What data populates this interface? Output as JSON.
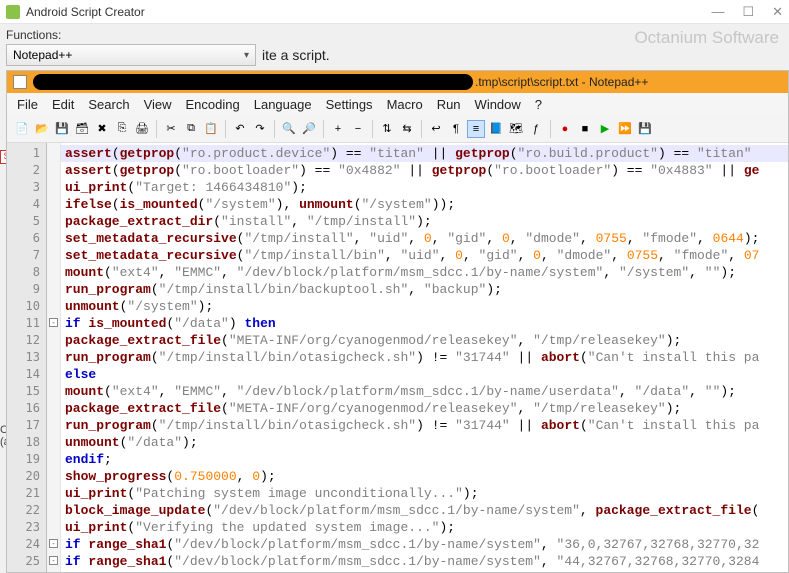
{
  "outer": {
    "title": "Android Script Creator",
    "win_min": "—",
    "win_max": "☐",
    "win_close": "✕",
    "functions_label": "Functions:",
    "selected_function": "Notepad++",
    "hint": "ite a script.",
    "brand": "Octanium Software"
  },
  "npp": {
    "title_path": ".tmp\\script\\script.txt - Notepad++",
    "menu": [
      "File",
      "Edit",
      "Search",
      "View",
      "Encoding",
      "Language",
      "Settings",
      "Macro",
      "Run",
      "Window",
      "?"
    ]
  },
  "code": {
    "lines": [
      {
        "n": 1,
        "hl": true,
        "tokens": [
          [
            "fn",
            "assert"
          ],
          [
            "op",
            "("
          ],
          [
            "fn",
            "getprop"
          ],
          [
            "op",
            "("
          ],
          [
            "str",
            "\"ro.product.device\""
          ],
          [
            "op",
            ") == "
          ],
          [
            "str",
            "\"titan\""
          ],
          [
            "op",
            " || "
          ],
          [
            "fn",
            "getprop"
          ],
          [
            "op",
            "("
          ],
          [
            "str",
            "\"ro.build.product\""
          ],
          [
            "op",
            ") == "
          ],
          [
            "str",
            "\"titan\""
          ]
        ]
      },
      {
        "n": 2,
        "tokens": [
          [
            "fn",
            "assert"
          ],
          [
            "op",
            "("
          ],
          [
            "fn",
            "getprop"
          ],
          [
            "op",
            "("
          ],
          [
            "str",
            "\"ro.bootloader\""
          ],
          [
            "op",
            ") == "
          ],
          [
            "str",
            "\"0x4882\""
          ],
          [
            "op",
            " || "
          ],
          [
            "fn",
            "getprop"
          ],
          [
            "op",
            "("
          ],
          [
            "str",
            "\"ro.bootloader\""
          ],
          [
            "op",
            ") == "
          ],
          [
            "str",
            "\"0x4883\""
          ],
          [
            "op",
            " || "
          ],
          [
            "fn",
            "ge"
          ]
        ]
      },
      {
        "n": 3,
        "tokens": [
          [
            "fn",
            "ui_print"
          ],
          [
            "op",
            "("
          ],
          [
            "str",
            "\"Target: 1466434810\""
          ],
          [
            "op",
            ");"
          ]
        ]
      },
      {
        "n": 4,
        "tokens": [
          [
            "fn",
            "ifelse"
          ],
          [
            "op",
            "("
          ],
          [
            "fn",
            "is_mounted"
          ],
          [
            "op",
            "("
          ],
          [
            "str",
            "\"/system\""
          ],
          [
            "op",
            "), "
          ],
          [
            "fn",
            "unmount"
          ],
          [
            "op",
            "("
          ],
          [
            "str",
            "\"/system\""
          ],
          [
            "op",
            "));"
          ]
        ]
      },
      {
        "n": 5,
        "tokens": [
          [
            "fn",
            "package_extract_dir"
          ],
          [
            "op",
            "("
          ],
          [
            "str",
            "\"install\""
          ],
          [
            "op",
            ", "
          ],
          [
            "str",
            "\"/tmp/install\""
          ],
          [
            "op",
            ");"
          ]
        ]
      },
      {
        "n": 6,
        "tokens": [
          [
            "fn",
            "set_metadata_recursive"
          ],
          [
            "op",
            "("
          ],
          [
            "str",
            "\"/tmp/install\""
          ],
          [
            "op",
            ", "
          ],
          [
            "str",
            "\"uid\""
          ],
          [
            "op",
            ", "
          ],
          [
            "num",
            "0"
          ],
          [
            "op",
            ", "
          ],
          [
            "str",
            "\"gid\""
          ],
          [
            "op",
            ", "
          ],
          [
            "num",
            "0"
          ],
          [
            "op",
            ", "
          ],
          [
            "str",
            "\"dmode\""
          ],
          [
            "op",
            ", "
          ],
          [
            "num",
            "0755"
          ],
          [
            "op",
            ", "
          ],
          [
            "str",
            "\"fmode\""
          ],
          [
            "op",
            ", "
          ],
          [
            "num",
            "0644"
          ],
          [
            "op",
            ");"
          ]
        ]
      },
      {
        "n": 7,
        "tokens": [
          [
            "fn",
            "set_metadata_recursive"
          ],
          [
            "op",
            "("
          ],
          [
            "str",
            "\"/tmp/install/bin\""
          ],
          [
            "op",
            ", "
          ],
          [
            "str",
            "\"uid\""
          ],
          [
            "op",
            ", "
          ],
          [
            "num",
            "0"
          ],
          [
            "op",
            ", "
          ],
          [
            "str",
            "\"gid\""
          ],
          [
            "op",
            ", "
          ],
          [
            "num",
            "0"
          ],
          [
            "op",
            ", "
          ],
          [
            "str",
            "\"dmode\""
          ],
          [
            "op",
            ", "
          ],
          [
            "num",
            "0755"
          ],
          [
            "op",
            ", "
          ],
          [
            "str",
            "\"fmode\""
          ],
          [
            "op",
            ", "
          ],
          [
            "num",
            "07"
          ]
        ]
      },
      {
        "n": 8,
        "tokens": [
          [
            "fn",
            "mount"
          ],
          [
            "op",
            "("
          ],
          [
            "str",
            "\"ext4\""
          ],
          [
            "op",
            ", "
          ],
          [
            "str",
            "\"EMMC\""
          ],
          [
            "op",
            ", "
          ],
          [
            "str",
            "\"/dev/block/platform/msm_sdcc.1/by-name/system\""
          ],
          [
            "op",
            ", "
          ],
          [
            "str",
            "\"/system\""
          ],
          [
            "op",
            ", "
          ],
          [
            "str",
            "\"\""
          ],
          [
            "op",
            ");"
          ]
        ]
      },
      {
        "n": 9,
        "tokens": [
          [
            "fn",
            "run_program"
          ],
          [
            "op",
            "("
          ],
          [
            "str",
            "\"/tmp/install/bin/backuptool.sh\""
          ],
          [
            "op",
            ", "
          ],
          [
            "str",
            "\"backup\""
          ],
          [
            "op",
            ");"
          ]
        ]
      },
      {
        "n": 10,
        "tokens": [
          [
            "fn",
            "unmount"
          ],
          [
            "op",
            "("
          ],
          [
            "str",
            "\"/system\""
          ],
          [
            "op",
            ");"
          ]
        ]
      },
      {
        "n": 11,
        "fold": "-",
        "tokens": [
          [
            "kw",
            "if"
          ],
          [
            "op",
            " "
          ],
          [
            "fn",
            "is_mounted"
          ],
          [
            "op",
            "("
          ],
          [
            "str",
            "\"/data\""
          ],
          [
            "op",
            ") "
          ],
          [
            "kw",
            "then"
          ]
        ]
      },
      {
        "n": 12,
        "tokens": [
          [
            "fn",
            "package_extract_file"
          ],
          [
            "op",
            "("
          ],
          [
            "str",
            "\"META-INF/org/cyanogenmod/releasekey\""
          ],
          [
            "op",
            ", "
          ],
          [
            "str",
            "\"/tmp/releasekey\""
          ],
          [
            "op",
            ");"
          ]
        ]
      },
      {
        "n": 13,
        "tokens": [
          [
            "fn",
            "run_program"
          ],
          [
            "op",
            "("
          ],
          [
            "str",
            "\"/tmp/install/bin/otasigcheck.sh\""
          ],
          [
            "op",
            ") != "
          ],
          [
            "str",
            "\"31744\""
          ],
          [
            "op",
            " || "
          ],
          [
            "fn",
            "abort"
          ],
          [
            "op",
            "("
          ],
          [
            "str",
            "\"Can't install this pa"
          ]
        ]
      },
      {
        "n": 14,
        "tokens": [
          [
            "kw",
            "else"
          ]
        ]
      },
      {
        "n": 15,
        "tokens": [
          [
            "fn",
            "mount"
          ],
          [
            "op",
            "("
          ],
          [
            "str",
            "\"ext4\""
          ],
          [
            "op",
            ", "
          ],
          [
            "str",
            "\"EMMC\""
          ],
          [
            "op",
            ", "
          ],
          [
            "str",
            "\"/dev/block/platform/msm_sdcc.1/by-name/userdata\""
          ],
          [
            "op",
            ", "
          ],
          [
            "str",
            "\"/data\""
          ],
          [
            "op",
            ", "
          ],
          [
            "str",
            "\"\""
          ],
          [
            "op",
            ");"
          ]
        ]
      },
      {
        "n": 16,
        "tokens": [
          [
            "fn",
            "package_extract_file"
          ],
          [
            "op",
            "("
          ],
          [
            "str",
            "\"META-INF/org/cyanogenmod/releasekey\""
          ],
          [
            "op",
            ", "
          ],
          [
            "str",
            "\"/tmp/releasekey\""
          ],
          [
            "op",
            ");"
          ]
        ]
      },
      {
        "n": 17,
        "tokens": [
          [
            "fn",
            "run_program"
          ],
          [
            "op",
            "("
          ],
          [
            "str",
            "\"/tmp/install/bin/otasigcheck.sh\""
          ],
          [
            "op",
            ") != "
          ],
          [
            "str",
            "\"31744\""
          ],
          [
            "op",
            " || "
          ],
          [
            "fn",
            "abort"
          ],
          [
            "op",
            "("
          ],
          [
            "str",
            "\"Can't install this pa"
          ]
        ]
      },
      {
        "n": 18,
        "tokens": [
          [
            "fn",
            "unmount"
          ],
          [
            "op",
            "("
          ],
          [
            "str",
            "\"/data\""
          ],
          [
            "op",
            ");"
          ]
        ]
      },
      {
        "n": 19,
        "tokens": [
          [
            "kw",
            "endif"
          ],
          [
            "op",
            ";"
          ]
        ]
      },
      {
        "n": 20,
        "tokens": [
          [
            "fn",
            "show_progress"
          ],
          [
            "op",
            "("
          ],
          [
            "num",
            "0.750000"
          ],
          [
            "op",
            ", "
          ],
          [
            "num",
            "0"
          ],
          [
            "op",
            ");"
          ]
        ]
      },
      {
        "n": 21,
        "tokens": [
          [
            "fn",
            "ui_print"
          ],
          [
            "op",
            "("
          ],
          [
            "str",
            "\"Patching system image unconditionally...\""
          ],
          [
            "op",
            ");"
          ]
        ]
      },
      {
        "n": 22,
        "tokens": [
          [
            "fn",
            "block_image_update"
          ],
          [
            "op",
            "("
          ],
          [
            "str",
            "\"/dev/block/platform/msm_sdcc.1/by-name/system\""
          ],
          [
            "op",
            ", "
          ],
          [
            "fn",
            "package_extract_file"
          ],
          [
            "op",
            "("
          ]
        ]
      },
      {
        "n": 23,
        "tokens": [
          [
            "fn",
            "ui_print"
          ],
          [
            "op",
            "("
          ],
          [
            "str",
            "\"Verifying the updated system image...\""
          ],
          [
            "op",
            ");"
          ]
        ]
      },
      {
        "n": 24,
        "fold": "-",
        "tokens": [
          [
            "kw",
            "if"
          ],
          [
            "op",
            " "
          ],
          [
            "fn",
            "range_sha1"
          ],
          [
            "op",
            "("
          ],
          [
            "str",
            "\"/dev/block/platform/msm_sdcc.1/by-name/system\""
          ],
          [
            "op",
            ", "
          ],
          [
            "str",
            "\"36,0,32767,32768,32770,32"
          ]
        ]
      },
      {
        "n": 25,
        "fold": "-",
        "tokens": [
          [
            "kw",
            "if"
          ],
          [
            "op",
            " "
          ],
          [
            "fn",
            "range_sha1"
          ],
          [
            "op",
            "("
          ],
          [
            "str",
            "\"/dev/block/platform/msm_sdcc.1/by-name/system\""
          ],
          [
            "op",
            ", "
          ],
          [
            "str",
            "\"44,32767,32768,32770,3284"
          ]
        ]
      }
    ]
  },
  "left": {
    "su": "Su",
    "c": "C",
    "as": "(as"
  }
}
